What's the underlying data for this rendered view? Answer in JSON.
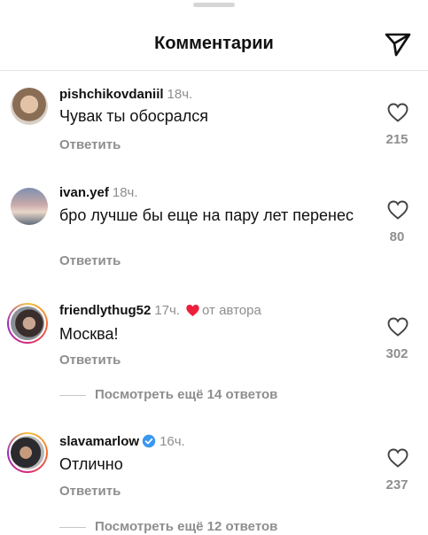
{
  "header": {
    "title": "Комментарии"
  },
  "comments": [
    {
      "username": "pishchikovdaniil",
      "time": "18ч.",
      "text": "Чувак ты обосрался",
      "reply_label": "Ответить",
      "likes": "215",
      "verified": false,
      "liked_by_author": false
    },
    {
      "username": "ivan.yef",
      "time": "18ч.",
      "text": "бро лучше бы еще на пару лет перенес",
      "reply_label": "Ответить",
      "likes": "80",
      "verified": false,
      "liked_by_author": false
    },
    {
      "username": "friendlythug52",
      "time": "17ч.",
      "author_label": "от автора",
      "text": "Москва!",
      "reply_label": "Ответить",
      "likes": "302",
      "verified": false,
      "liked_by_author": true,
      "view_replies": "Посмотреть ещё 14 ответов"
    },
    {
      "username": "slavamarlow",
      "time": "16ч.",
      "text": "Отлично",
      "reply_label": "Ответить",
      "likes": "237",
      "verified": true,
      "liked_by_author": false,
      "view_replies": "Посмотреть ещё 12 ответов"
    }
  ],
  "icons": {
    "share": "paper-plane-icon",
    "like": "heart-outline-icon",
    "author_like": "heart-filled-icon",
    "verified": "verified-badge-icon"
  },
  "colors": {
    "author_heart": "#ed1f3c",
    "verified_badge": "#3897f0",
    "secondary_text": "#8e8e8e"
  }
}
